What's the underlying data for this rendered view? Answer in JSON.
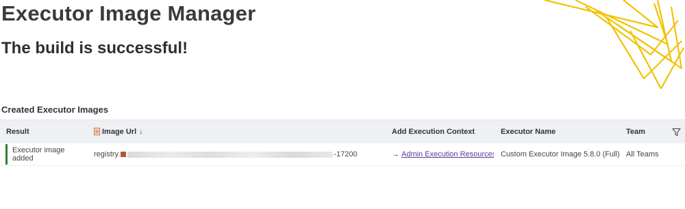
{
  "header": {
    "title": "Executor Image Manager",
    "subtitle": "The build is successful!"
  },
  "section": {
    "title": "Created Executor Images"
  },
  "table": {
    "columns": {
      "result": "Result",
      "image_url": "Image Url",
      "add_context": "Add Execution Context",
      "executor_name": "Executor Name",
      "team": "Team"
    },
    "rows": [
      {
        "result": "Executor image added",
        "url_prefix": "registry.",
        "url_suffix": "-17200",
        "context_link": "Admin Execution Resources",
        "executor_name": "Custom Executor Image 5.8.0 (Full)",
        "team": "All Teams"
      }
    ]
  },
  "colors": {
    "accent_success": "#2e7d32",
    "decor_yellow": "#f2c200",
    "link": "#5b3a9a"
  }
}
